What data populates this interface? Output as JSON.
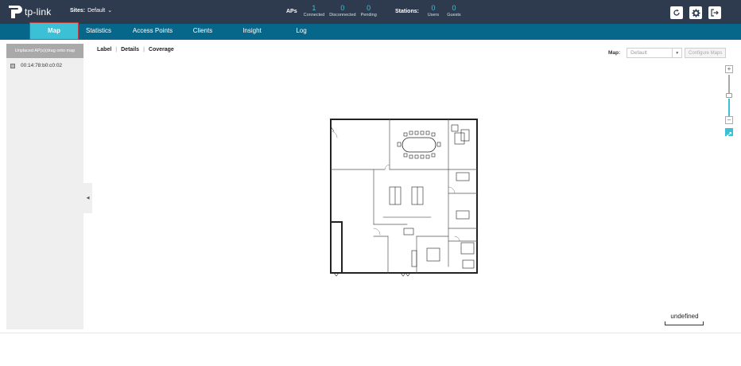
{
  "header": {
    "logo_text": "tp-link",
    "sites_label": "Sites:",
    "sites_value": "Default",
    "aps_label": "APs",
    "aps": [
      {
        "value": "1",
        "label": "Connected"
      },
      {
        "value": "0",
        "label": "Disconnected"
      },
      {
        "value": "0",
        "label": "Pending"
      }
    ],
    "stations_label": "Stations:",
    "stations": [
      {
        "value": "0",
        "label": "Users"
      },
      {
        "value": "0",
        "label": "Guests"
      }
    ],
    "icons": [
      "refresh-icon",
      "gear-icon",
      "logout-icon"
    ],
    "accent": "#3cc0d6",
    "bg": "#2e3b4e"
  },
  "nav": {
    "tabs": [
      {
        "label": "Map",
        "active": true
      },
      {
        "label": "Statistics"
      },
      {
        "label": "Access Points"
      },
      {
        "label": "Clients"
      },
      {
        "label": "Insight"
      },
      {
        "label": "Log"
      }
    ],
    "bg": "#07678a"
  },
  "sidebar": {
    "header": "Unplaced AP(s)(drag onto map",
    "aps": [
      {
        "mac": "00:14:78:b0:c0:02"
      }
    ]
  },
  "map": {
    "view_tabs": [
      "Label",
      "Details",
      "Coverage"
    ],
    "map_label": "Map:",
    "map_select_value": "Default",
    "configure_button": "Configure Maps",
    "scale_text": "undefined"
  }
}
